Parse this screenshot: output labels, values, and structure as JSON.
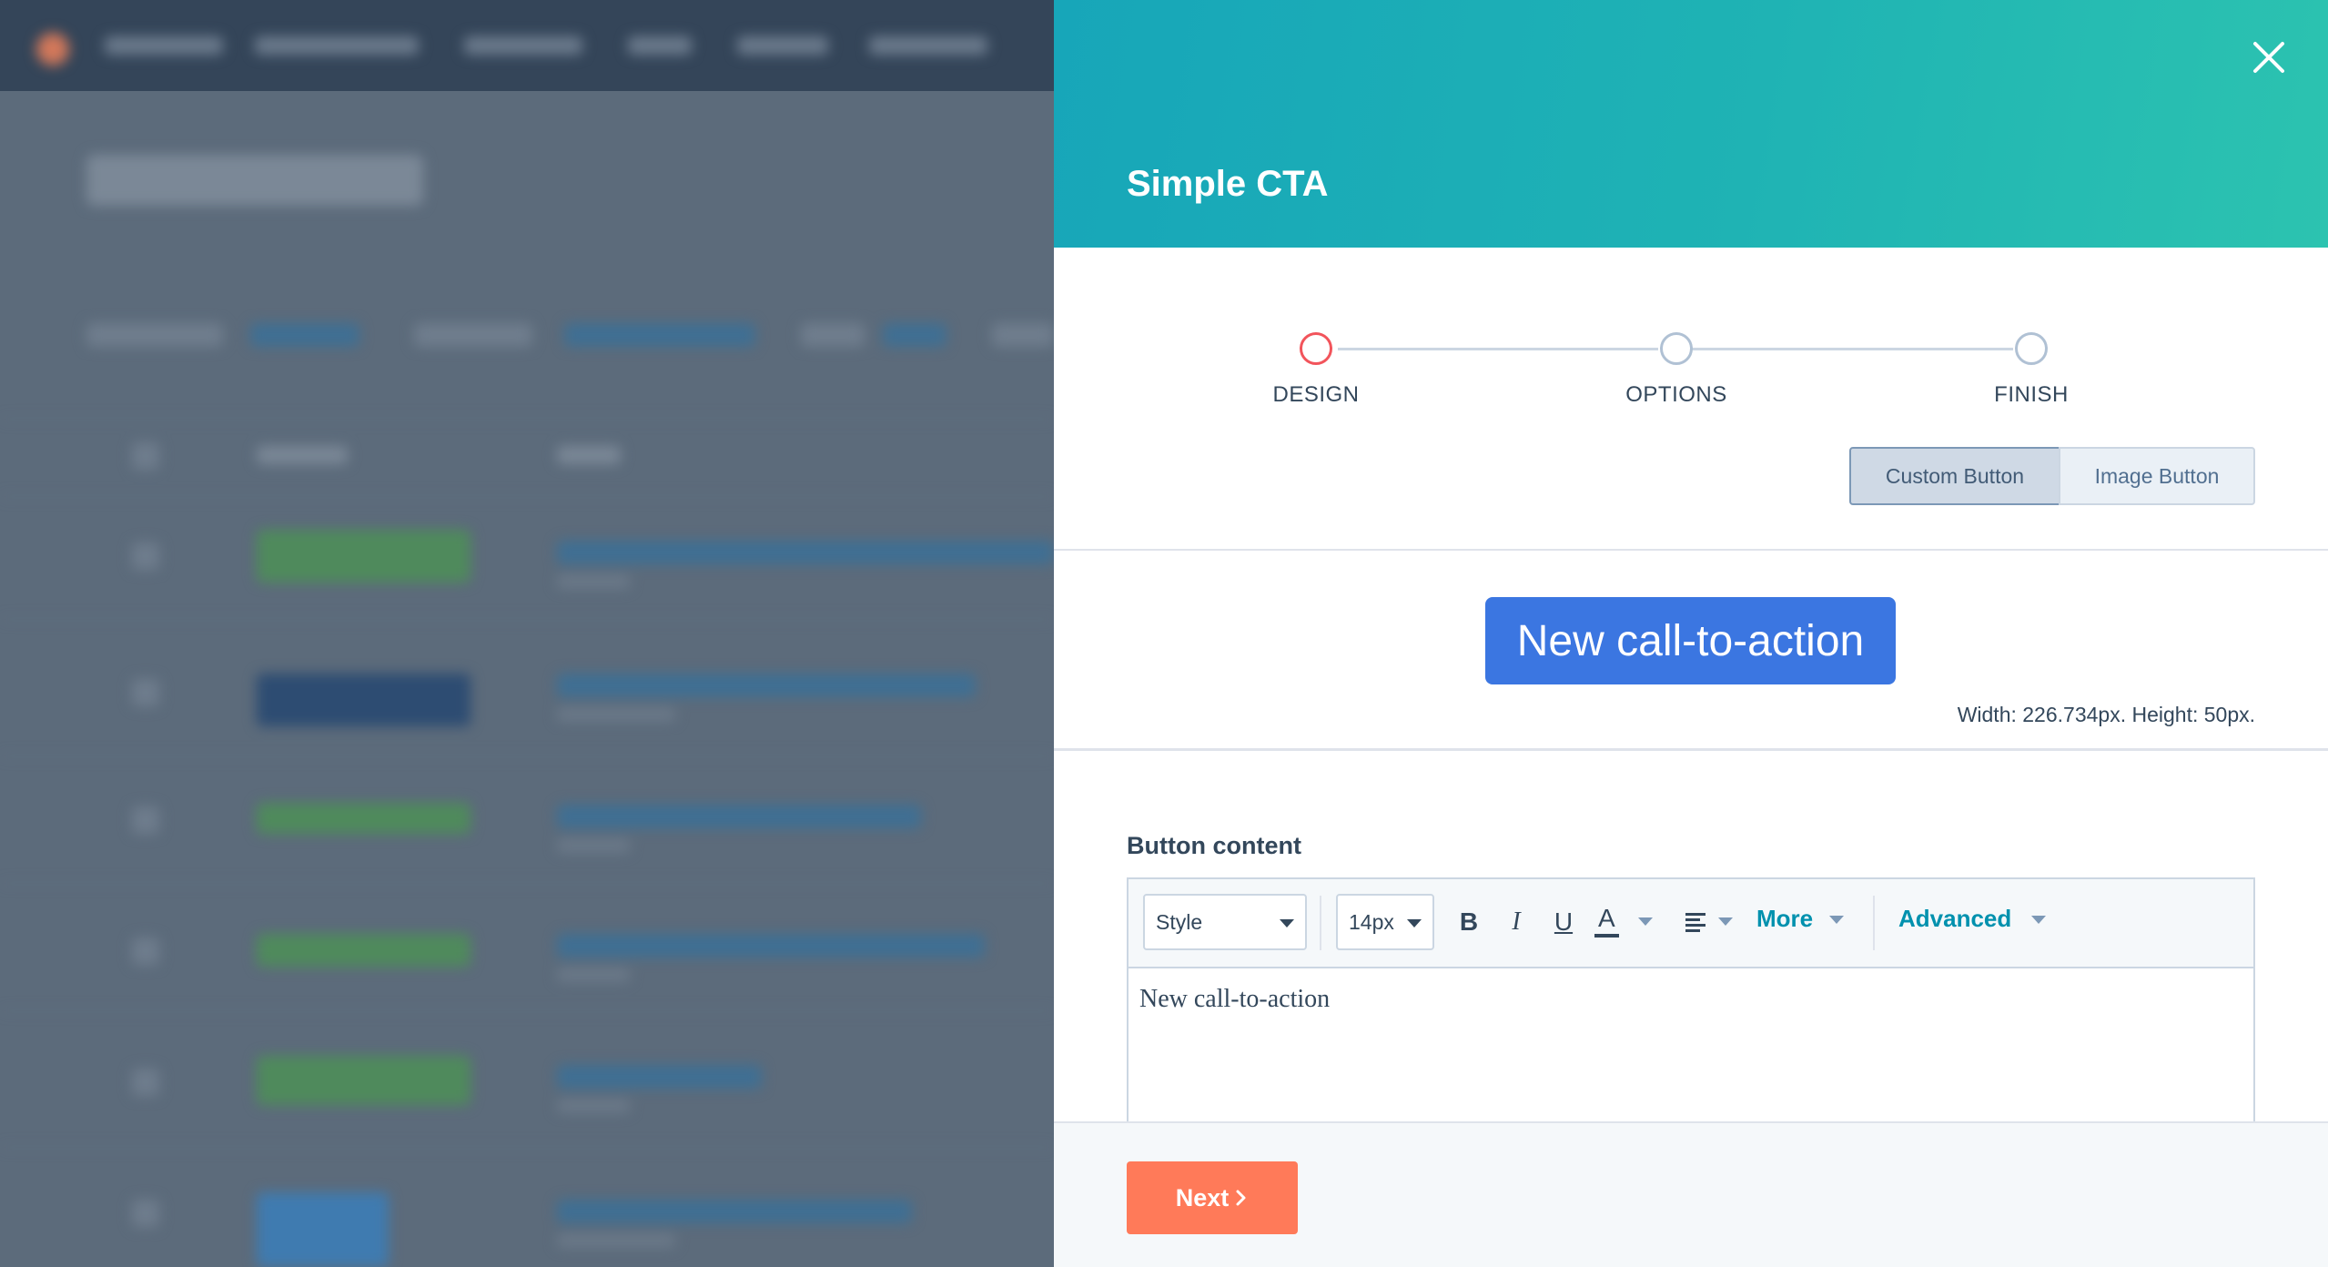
{
  "background_app": {
    "description_visible": false
  },
  "modal": {
    "title": "Simple CTA",
    "close_icon": "close-icon",
    "steps": [
      {
        "label": "DESIGN",
        "state": "current"
      },
      {
        "label": "OPTIONS",
        "state": "upcoming"
      },
      {
        "label": "FINISH",
        "state": "upcoming"
      }
    ],
    "button_type_toggle": {
      "options": [
        "Custom Button",
        "Image Button"
      ],
      "selected": "Custom Button"
    },
    "preview": {
      "button_text": "New call-to-action",
      "dimensions_text": "Width: 226.734px. Height: 50px."
    },
    "editor": {
      "label": "Button content",
      "style_select": "Style",
      "font_size_select": "14px",
      "bold": "B",
      "italic": "I",
      "underline": "U",
      "text_color": "A",
      "more_label": "More",
      "advanced_label": "Advanced",
      "content": "New call-to-action"
    },
    "footer": {
      "next_label": "Next",
      "next_icon": "chevron-right-icon"
    }
  },
  "colors": {
    "header_gradient_start": "#17a6b9",
    "header_gradient_end": "#2cc3b0",
    "current_step": "#f2545b",
    "cta_blue": "#3b76e1",
    "next_orange": "#ff7a59",
    "link_teal": "#0091ae",
    "text_dark": "#33475b"
  }
}
